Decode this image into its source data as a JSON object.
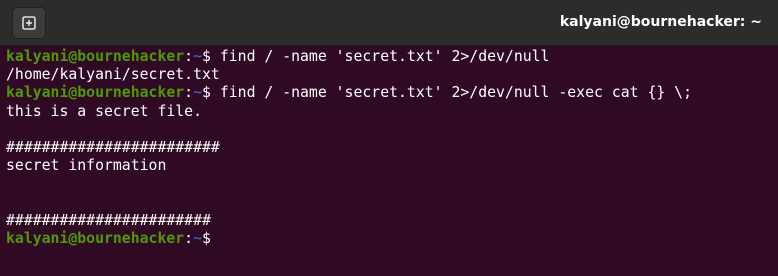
{
  "window": {
    "title": "kalyani@bournehacker: ~",
    "new_tab_icon": "new-tab-icon"
  },
  "prompt": {
    "user_host": "kalyani@bournehacker",
    "separator": ":",
    "path": "~",
    "symbol": "$ "
  },
  "lines": [
    {
      "type": "command",
      "text": "find / -name 'secret.txt' 2>/dev/null"
    },
    {
      "type": "output",
      "text": "/home/kalyani/secret.txt"
    },
    {
      "type": "command",
      "text": "find / -name 'secret.txt' 2>/dev/null -exec cat {} \\;"
    },
    {
      "type": "output",
      "text": "this is a secret file."
    },
    {
      "type": "output",
      "text": ""
    },
    {
      "type": "output",
      "text": "########################"
    },
    {
      "type": "output",
      "text": "secret information"
    },
    {
      "type": "output",
      "text": ""
    },
    {
      "type": "output",
      "text": ""
    },
    {
      "type": "output",
      "text": "#######################"
    },
    {
      "type": "command",
      "text": ""
    }
  ],
  "colors": {
    "background": "#300a24",
    "titlebar": "#2c2c2c",
    "prompt_user": "#4e9a06",
    "prompt_path": "#3465a4",
    "text": "#ffffff"
  }
}
